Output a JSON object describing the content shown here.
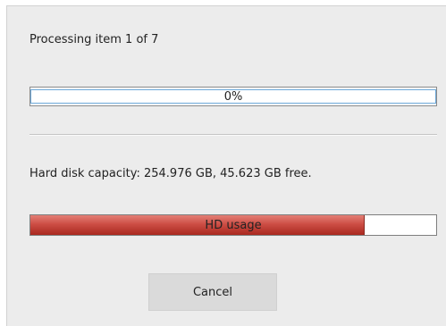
{
  "status": {
    "text": "Processing item 1 of 7"
  },
  "progress": {
    "label": "0%",
    "fraction": 0
  },
  "disk": {
    "info": "Hard disk capacity: 254.976 GB, 45.623 GB free.",
    "usage_label": "HD usage",
    "used_fraction": 0.8211
  },
  "buttons": {
    "cancel_label": "Cancel"
  },
  "colors": {
    "dialog_background": "#ececec",
    "hd_usage_fill": "#cd4e45",
    "progress_accent": "#4a90d0"
  }
}
